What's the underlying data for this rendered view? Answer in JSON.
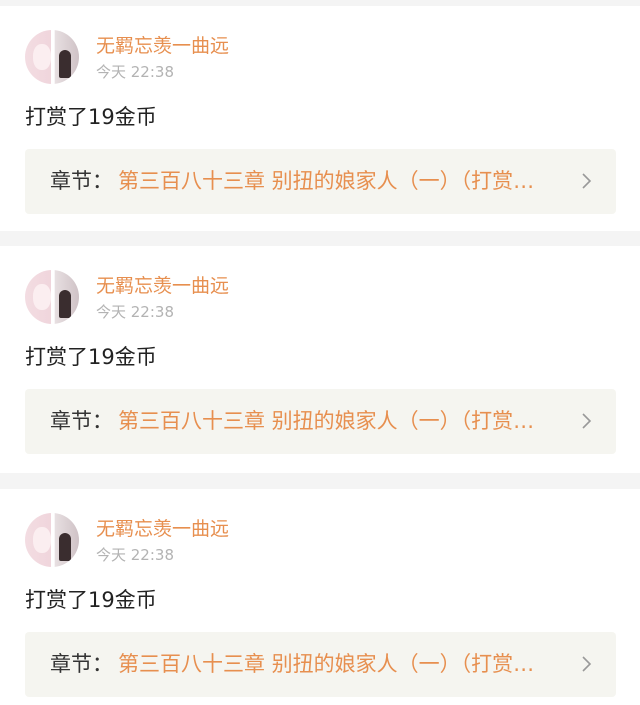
{
  "feed": {
    "items": [
      {
        "username": "无羁忘羡一曲远",
        "time": "今天 22:38",
        "message": "打赏了19金币",
        "chapter_prefix": "章节：",
        "chapter_title": "第三百八十三章 别扭的娘家人（一）（打赏…"
      },
      {
        "username": "无羁忘羡一曲远",
        "time": "今天 22:38",
        "message": "打赏了19金币",
        "chapter_prefix": "章节：",
        "chapter_title": "第三百八十三章 别扭的娘家人（一）（打赏…"
      },
      {
        "username": "无羁忘羡一曲远",
        "time": "今天 22:38",
        "message": "打赏了19金币",
        "chapter_prefix": "章节：",
        "chapter_title": "第三百八十三章 别扭的娘家人（一）（打赏…"
      }
    ]
  },
  "colors": {
    "accent": "#e78f4f",
    "background": "#f4f4f4",
    "chapter_box": "#f5f5f0",
    "text": "#222222",
    "muted": "#b3b3b3"
  },
  "icons": {
    "chapter_link": "chevron-right-icon",
    "avatar": "avatar"
  }
}
